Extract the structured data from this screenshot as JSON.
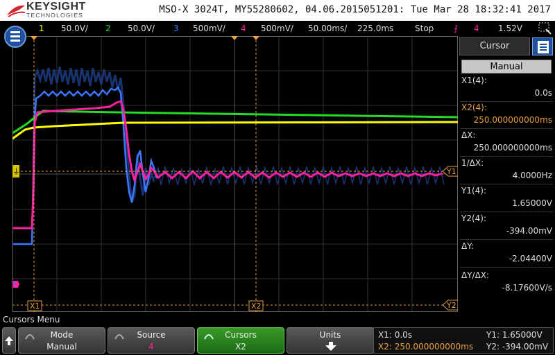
{
  "header": {
    "brand": "KEYSIGHT",
    "brand_sub": "TECHNOLOGIES",
    "instrument": "MSO-X 3024T, MY55280602, 04.06.2015051201: Tue Mar 28 18:32:41 2017"
  },
  "status_bar": {
    "ch1_num": "1",
    "ch1_scale": "50.0V/",
    "ch2_num": "2",
    "ch2_scale": "50.0V/",
    "ch3_num": "3",
    "ch3_scale": "500mV/",
    "ch4_num": "4",
    "ch4_scale": "500mV/",
    "timebase": "50.00ms/",
    "delay": "225.0ms",
    "run_state": "Stop",
    "trigger_source": "4",
    "trigger_level": "1.52V"
  },
  "markers": {
    "ground": "⏚",
    "x1": "X1",
    "x2": "X2",
    "y1": "Y1",
    "y2": "Y2",
    "trig_left": "T"
  },
  "side_panel": {
    "tab": "Cursor",
    "mode": "Manual",
    "rows": [
      {
        "label": "X1(4):",
        "value": "0.0s"
      },
      {
        "label": "X2(4):",
        "value": "250.000000000ms"
      },
      {
        "label": "ΔX:",
        "value": "250.000000000ms"
      },
      {
        "label": "1/ΔX:",
        "value": "4.0000Hz"
      },
      {
        "label": "Y1(4):",
        "value": "1.65000V"
      },
      {
        "label": "Y2(4):",
        "value": "-394.00mV"
      },
      {
        "label": "ΔY:",
        "value": "-2.04400V"
      },
      {
        "label": "ΔY/ΔX:",
        "value": "-8.17600V/s"
      }
    ]
  },
  "softkeys": {
    "menu_title": "Cursors Menu",
    "mode_label": "Mode",
    "mode_value": "Manual",
    "source_label": "Source",
    "source_value": "4",
    "cursors_label": "Cursors",
    "cursors_value": "X2",
    "units_label": "Units"
  },
  "readout": {
    "x1": "X1:  0.0s",
    "x2": "X2:  250.000000000ms",
    "y1": "Y1: 1.65000V",
    "y2": "Y2: -394.00mV"
  },
  "colors": {
    "ch1": "#ffff00",
    "ch2": "#22dd22",
    "ch3": "#3c78ff",
    "ch4": "#ff1fa0",
    "cursor": "#e8a040",
    "grid": "#3a3a3a"
  },
  "waveforms": [
    {
      "channel": "1",
      "shape": "yellow step, rising ramp to ~173 then flat"
    },
    {
      "channel": "2",
      "shape": "green step, rising ramp to ~160 then flat ~167"
    },
    {
      "channel": "3",
      "shape": "blue noisy burst then damped ringing"
    },
    {
      "channel": "4",
      "shape": "magenta step up, overshoot, then damped ringing settling near Y1"
    }
  ]
}
